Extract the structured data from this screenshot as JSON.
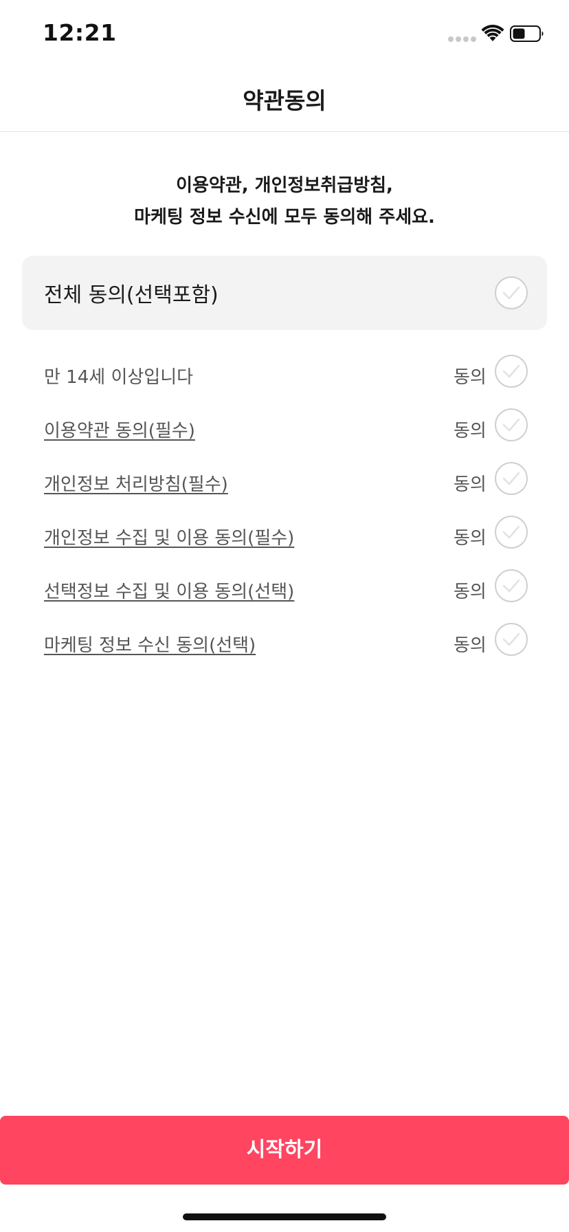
{
  "status_bar": {
    "time": "12:21",
    "icons": [
      "cellular-signal-icon",
      "wifi-icon",
      "battery-icon"
    ]
  },
  "nav": {
    "title": "약관동의"
  },
  "instruction": {
    "line1": "이용약관, 개인정보취급방침,",
    "line2": "마케팅 정보 수신에 모두 동의해 주세요."
  },
  "all_agree": {
    "label": "전체 동의(선택포함)",
    "checked": false
  },
  "terms": [
    {
      "label": "만 14세 이상입니다",
      "agree_text": "동의",
      "link": false,
      "checked": false
    },
    {
      "label": "이용약관 동의(필수)",
      "agree_text": "동의",
      "link": true,
      "checked": false
    },
    {
      "label": "개인정보 처리방침(필수)",
      "agree_text": "동의",
      "link": true,
      "checked": false
    },
    {
      "label": "개인정보 수집 및 이용 동의(필수)",
      "agree_text": "동의",
      "link": true,
      "checked": false
    },
    {
      "label": "선택정보 수집 및 이용 동의(선택)",
      "agree_text": "동의",
      "link": true,
      "checked": false
    },
    {
      "label": "마케팅 정보 수신 동의(선택)",
      "agree_text": "동의",
      "link": true,
      "checked": false
    }
  ],
  "start_button": {
    "label": "시작하기"
  },
  "colors": {
    "accent": "#ff4560",
    "check_border": "#cfcfcf",
    "all_agree_bg": "#f3f3f3",
    "text_secondary": "#555555"
  }
}
